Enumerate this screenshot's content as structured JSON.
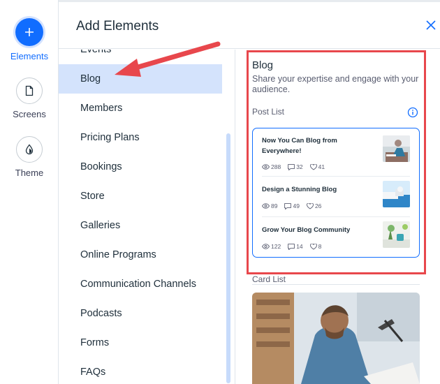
{
  "rail": {
    "items": [
      {
        "label": "Elements",
        "icon": "plus-icon",
        "active": true
      },
      {
        "label": "Screens",
        "icon": "page-icon",
        "active": false
      },
      {
        "label": "Theme",
        "icon": "drop-icon",
        "active": false
      }
    ]
  },
  "header": {
    "title": "Add Elements",
    "close_icon": "close-icon"
  },
  "categories": {
    "items": [
      "Events",
      "Blog",
      "Members",
      "Pricing Plans",
      "Bookings",
      "Store",
      "Galleries",
      "Online Programs",
      "Communication Channels",
      "Podcasts",
      "Forms",
      "FAQs"
    ],
    "selected": "Blog"
  },
  "panel": {
    "title": "Blog",
    "description": "Share your expertise and engage with your audience.",
    "post_list_label": "Post List",
    "card_list_label": "Card List",
    "posts": [
      {
        "title": "Now You Can Blog from Everywhere!",
        "views": "288",
        "comments": "32",
        "likes": "41"
      },
      {
        "title": "Design a Stunning Blog",
        "views": "89",
        "comments": "49",
        "likes": "26"
      },
      {
        "title": "Grow Your Blog Community",
        "views": "122",
        "comments": "14",
        "likes": "8"
      }
    ]
  },
  "colors": {
    "accent": "#116dff",
    "selected_bg": "#d4e3fc",
    "annotation_red": "#e8474c"
  }
}
